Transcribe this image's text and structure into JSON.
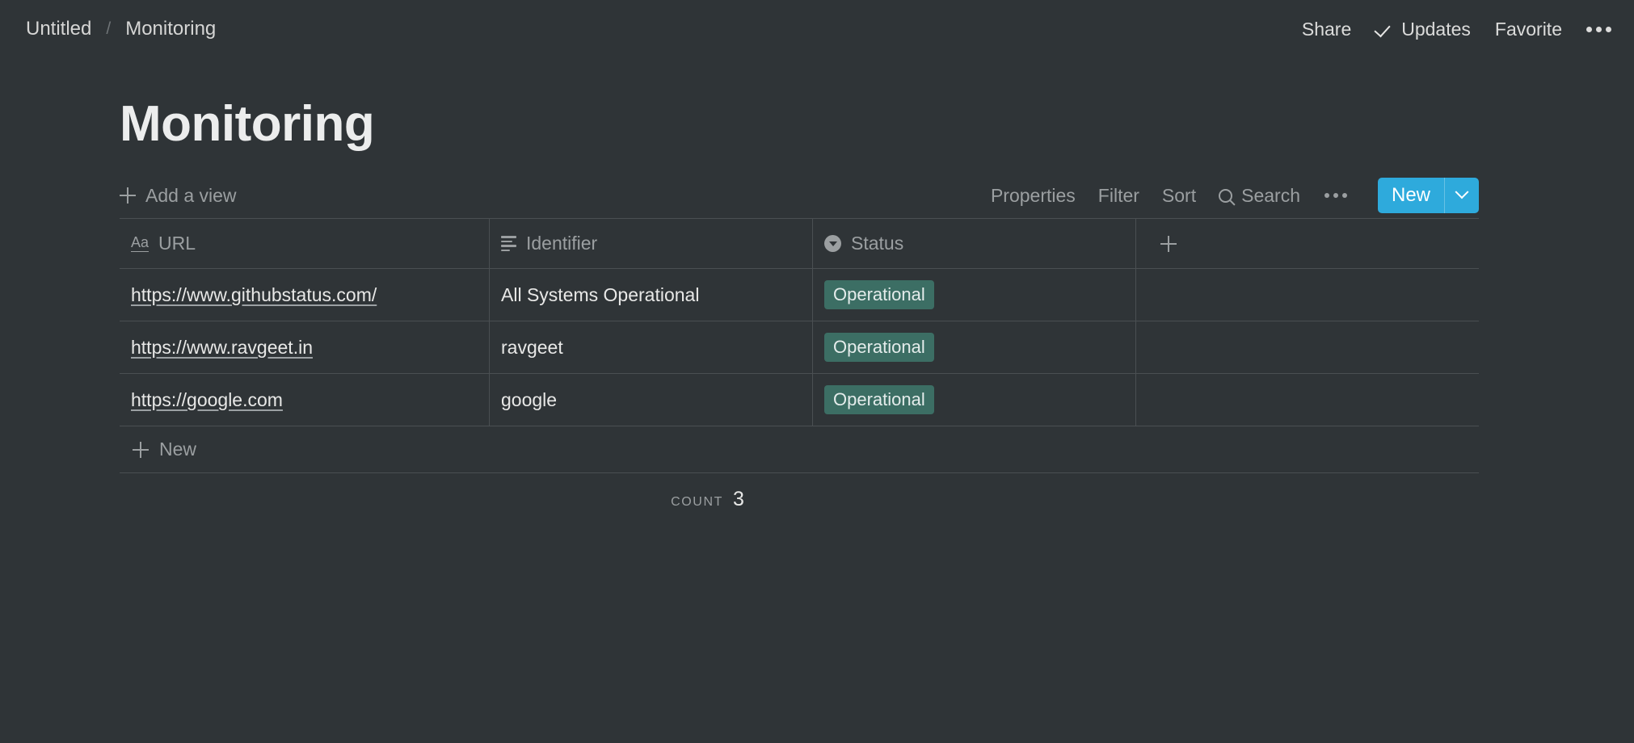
{
  "topbar": {
    "breadcrumb": {
      "parent": "Untitled",
      "separator": "/",
      "current": "Monitoring"
    },
    "share_label": "Share",
    "updates_label": "Updates",
    "favorite_label": "Favorite",
    "more_label": "•••"
  },
  "page": {
    "title": "Monitoring"
  },
  "view_toolbar": {
    "add_view_label": "Add a view",
    "properties_label": "Properties",
    "filter_label": "Filter",
    "sort_label": "Sort",
    "search_label": "Search",
    "more_label": "•••",
    "new_label": "New"
  },
  "table": {
    "columns": [
      {
        "label": "URL",
        "icon": "text-aa-icon",
        "type": "title"
      },
      {
        "label": "Identifier",
        "icon": "text-lines-icon",
        "type": "text"
      },
      {
        "label": "Status",
        "icon": "select-circle-icon",
        "type": "select"
      }
    ],
    "add_column_label": "+",
    "rows": [
      {
        "url": "https://www.githubstatus.com/",
        "identifier": "All Systems Operational",
        "status": "Operational"
      },
      {
        "url": "https://www.ravgeet.in",
        "identifier": "ravgeet",
        "status": "Operational"
      },
      {
        "url": "https://google.com",
        "identifier": "google",
        "status": "Operational"
      }
    ],
    "new_row_label": "New",
    "count_label": "Count",
    "count_value": "3"
  },
  "colors": {
    "background": "#2f3437",
    "accent_blue": "#2eaadc",
    "badge_green": "#3c6e64",
    "border": "#4a4f52",
    "muted_text": "#9b9fa1"
  }
}
